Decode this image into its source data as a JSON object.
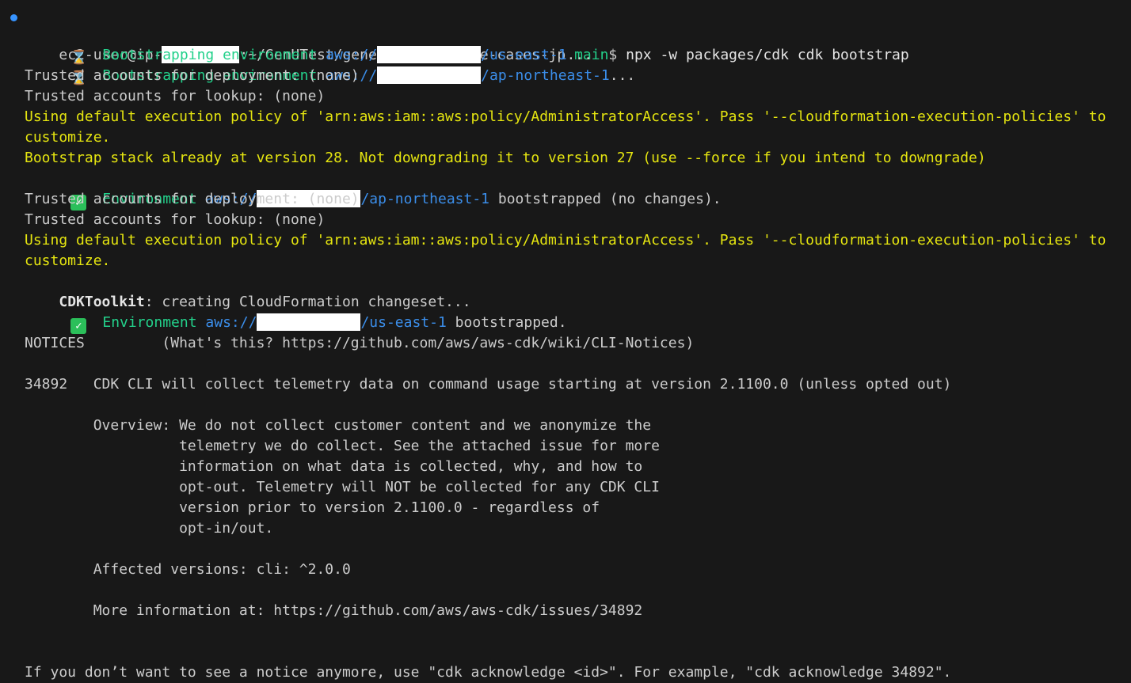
{
  "prompt": {
    "user_host": "ec2-user@ip-",
    "path": ":~/GenUTest/generative-ai-use-cases-jp",
    "branch": "main",
    "symbol": "$",
    "command": "npx -w packages/cdk cdk bootstrap"
  },
  "lines": {
    "boot1_label": "Bootstrapping environment",
    "boot1_aws": "aws://",
    "boot1_region": "/us-east-1",
    "boot1_dots": "...",
    "boot2_label": "Bootstrapping environment",
    "boot2_aws": "aws://",
    "boot2_region": "/ap-northeast-1",
    "boot2_dots": "...",
    "trusted_deploy_1": "Trusted accounts for deployment: (none)",
    "trusted_lookup_1": "Trusted accounts for lookup: (none)",
    "policy_1a": "Using default execution policy of 'arn:aws:iam::aws:policy/AdministratorAccess'. Pass '--cloudformation-execution-policies' to",
    "policy_1b": "customize.",
    "bootstrap_version": "Bootstrap stack already at version 28. Not downgrading it to version 27 (use --force if you intend to downgrade)",
    "env1_label": "Environment",
    "env1_aws": "aws://",
    "env1_region": "/ap-northeast-1",
    "env1_status": "bootstrapped (no changes).",
    "trusted_deploy_2": "Trusted accounts for deployment: (none)",
    "trusted_lookup_2": "Trusted accounts for lookup: (none)",
    "policy_2a": "Using default execution policy of 'arn:aws:iam::aws:policy/AdministratorAccess'. Pass '--cloudformation-execution-policies' to",
    "policy_2b": "customize.",
    "cdktoolkit_name": "CDKToolkit",
    "cdktoolkit_msg": ": creating CloudFormation changeset...",
    "env2_label": "Environment",
    "env2_aws": "aws://",
    "env2_region": "/us-east-1",
    "env2_status": "bootstrapped.",
    "notices_header": "NOTICES         (What's this? https://github.com/aws/aws-cdk/wiki/CLI-Notices)",
    "notice_title": "34892   CDK CLI will collect telemetry data on command usage starting at version 2.1100.0 (unless opted out)",
    "overview_1": "        Overview: We do not collect customer content and we anonymize the",
    "overview_2": "                  telemetry we do collect. See the attached issue for more",
    "overview_3": "                  information on what data is collected, why, and how to",
    "overview_4": "                  opt-out. Telemetry will NOT be collected for any CDK CLI",
    "overview_5": "                  version prior to version 2.1100.0 - regardless of",
    "overview_6": "                  opt-in/out.",
    "affected": "        Affected versions: cli: ^2.0.0",
    "more_info": "        More information at: https://github.com/aws/aws-cdk/issues/34892",
    "acknowledge": "If you don’t want to see a notice anymore, use \"cdk acknowledge <id>\". For example, \"cdk acknowledge 34892\"."
  },
  "icons": {
    "prompt_marker": "status-dot",
    "bootstrapping": "hourglass-icon",
    "success": "check-icon"
  },
  "colors": {
    "background": "#181818",
    "text": "#cccccc",
    "green": "#23d18b",
    "blue": "#3b8eea",
    "yellow": "#e5e510",
    "redaction": "#ffffff"
  }
}
